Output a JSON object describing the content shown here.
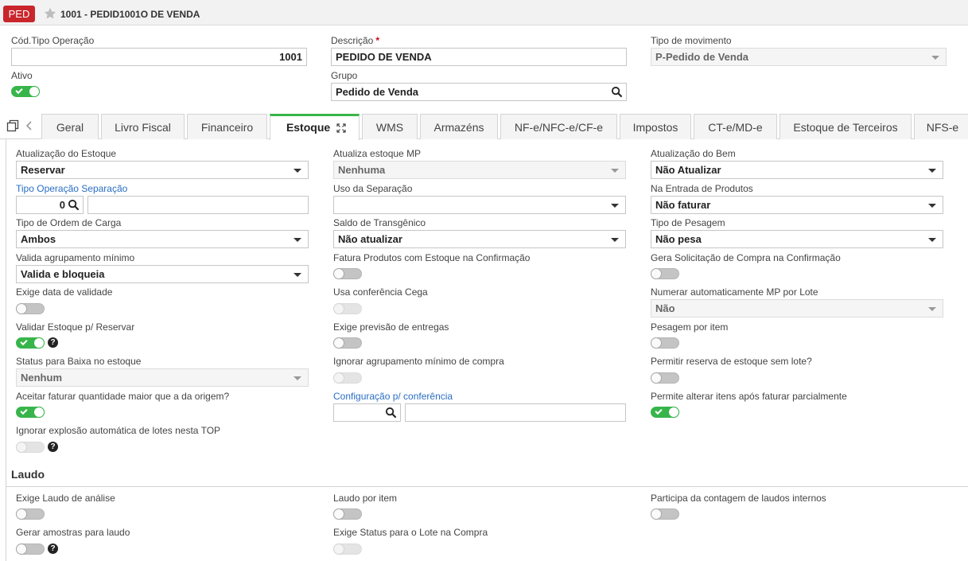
{
  "header": {
    "badge": "PED",
    "title": "1001 - PEDID1001O DE VENDA"
  },
  "top_form": {
    "cod_tipo_operacao": {
      "label": "Cód.Tipo Operação",
      "value": "1001"
    },
    "descricao": {
      "label": "Descrição",
      "required_mark": "*",
      "value": "PEDIDO DE VENDA"
    },
    "tipo_movimento": {
      "label": "Tipo de movimento",
      "value": "P-Pedido de Venda"
    },
    "ativo": {
      "label": "Ativo",
      "on": true
    },
    "grupo": {
      "label": "Grupo",
      "value": "Pedido de Venda"
    }
  },
  "tabs": [
    {
      "label": "Geral"
    },
    {
      "label": "Livro Fiscal"
    },
    {
      "label": "Financeiro"
    },
    {
      "label": "Estoque",
      "active": true
    },
    {
      "label": "WMS"
    },
    {
      "label": "Armazéns"
    },
    {
      "label": "NF-e/NFC-e/CF-e"
    },
    {
      "label": "Impostos"
    },
    {
      "label": "CT-e/MD-e"
    },
    {
      "label": "Estoque de Terceiros"
    },
    {
      "label": "NFS-e"
    }
  ],
  "estoque": {
    "atualizacao_estoque": {
      "label": "Atualização do Estoque",
      "value": "Reservar"
    },
    "atualiza_estoque_mp": {
      "label": "Atualiza estoque MP",
      "value": "Nenhuma"
    },
    "atualizacao_bem": {
      "label": "Atualização do Bem",
      "value": "Não Atualizar"
    },
    "tipo_operacao_separacao": {
      "label": "Tipo Operação Separação",
      "code": "0",
      "desc": ""
    },
    "uso_separacao": {
      "label": "Uso da Separação",
      "value": ""
    },
    "na_entrada_produtos": {
      "label": "Na Entrada de Produtos",
      "value": "Não faturar"
    },
    "tipo_ordem_carga": {
      "label": "Tipo de Ordem de Carga",
      "value": "Ambos"
    },
    "saldo_transgenico": {
      "label": "Saldo de Transgênico",
      "value": "Não atualizar"
    },
    "tipo_pesagem": {
      "label": "Tipo de Pesagem",
      "value": "Não pesa"
    },
    "valida_agrupamento": {
      "label": "Valida agrupamento mínimo",
      "value": "Valida e bloqueia"
    },
    "fatura_produtos_confirmacao": {
      "label": "Fatura Produtos com Estoque na Confirmação",
      "on": false
    },
    "gera_solicitacao_compra": {
      "label": "Gera Solicitação de Compra na Confirmação",
      "on": false
    },
    "exige_data_validade": {
      "label": "Exige data de validade",
      "on": false
    },
    "usa_conferencia_cega": {
      "label": "Usa conferência Cega",
      "on": false,
      "disabled": true
    },
    "numerar_mp_lote": {
      "label": "Numerar automaticamente MP por Lote",
      "value": "Não"
    },
    "validar_estoque_reservar": {
      "label": "Validar Estoque p/ Reservar",
      "on": true
    },
    "exige_previsao_entregas": {
      "label": "Exige previsão de entregas",
      "on": false
    },
    "pesagem_por_item": {
      "label": "Pesagem por item",
      "on": false
    },
    "status_baixa_estoque": {
      "label": "Status para Baixa no estoque",
      "value": "Nenhum"
    },
    "ignorar_agrupamento_compra": {
      "label": "Ignorar agrupamento mínimo de compra",
      "on": false,
      "disabled": true
    },
    "permitir_reserva_sem_lote": {
      "label": "Permitir reserva de estoque sem lote?",
      "on": false
    },
    "aceitar_faturar_maior": {
      "label": "Aceitar faturar quantidade maior que a da origem?",
      "on": true
    },
    "configuracao_conferencia": {
      "label": "Configuração p/ conferência",
      "code": "",
      "desc": ""
    },
    "permite_alterar_itens": {
      "label": "Permite alterar itens após faturar parcialmente",
      "on": true
    },
    "ignorar_explosao_lotes": {
      "label": "Ignorar explosão automática de lotes nesta TOP",
      "on": false,
      "disabled": true
    }
  },
  "laudo": {
    "title": "Laudo",
    "exige_laudo_analise": {
      "label": "Exige Laudo de análise",
      "on": false
    },
    "laudo_por_item": {
      "label": "Laudo por item",
      "on": false
    },
    "participa_contagem": {
      "label": "Participa da contagem de laudos internos",
      "on": false
    },
    "gerar_amostras": {
      "label": "Gerar amostras para laudo",
      "on": false
    },
    "exige_status_lote": {
      "label": "Exige Status para o Lote na Compra",
      "on": false,
      "disabled": true
    }
  },
  "help_glyph": "?",
  "colors": {
    "badge": "#c9262c",
    "accent_green": "#38b54a",
    "link_blue": "#2a6ec4"
  },
  "icons": [
    "star-icon",
    "search-icon",
    "copy-icon",
    "chevron-left-icon",
    "expand-icon",
    "chevron-down-icon",
    "help-icon",
    "check-icon"
  ]
}
